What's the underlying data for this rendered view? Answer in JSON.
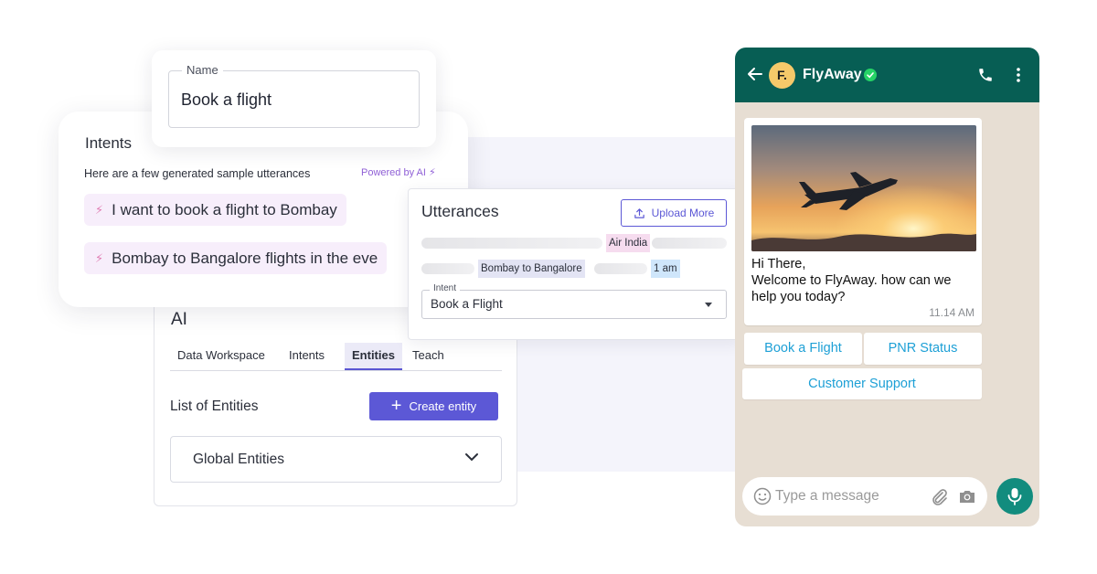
{
  "name_card": {
    "legend": "Name",
    "value": "Book a flight"
  },
  "intents_card": {
    "title": "Intents",
    "subtitle": "Here are a few generated sample utterances",
    "powered_by": "Powered by AI",
    "utterances": [
      "I want to book a flight to Bombay",
      "Bombay to Bangalore flights in the eve"
    ]
  },
  "ai_card": {
    "title": "AI",
    "tabs": [
      "Data Workspace",
      "Intents",
      "Entities",
      "Teach"
    ],
    "active_tab": "Entities",
    "list_label": "List of Entities",
    "create_button": "Create entity",
    "global_entities": "Global Entities"
  },
  "utterances_card": {
    "title": "Utterances",
    "upload_button": "Upload More",
    "tags": [
      "Air India",
      "Bombay to Bangalore",
      "1 am"
    ],
    "intent_legend": "Intent",
    "intent_value": "Book a Flight"
  },
  "whatsapp": {
    "avatar_initial": "F.",
    "contact_name": "FlyAway",
    "message_lines": [
      "Hi There,",
      "Welcome to FlyAway. how can we",
      "help you today?"
    ],
    "message_time": "11.14 AM",
    "quick_replies": [
      "Book a Flight",
      "PNR Status",
      "Customer Support"
    ],
    "input_placeholder": "Type a message",
    "colors": {
      "header": "#075e54",
      "chat_bg": "#e7ded3",
      "link": "#1ea0d6",
      "mic": "#128c7e",
      "verified": "#25d366"
    }
  },
  "colors": {
    "accent": "#5c58d6",
    "chip_bg": "#f7eefb",
    "powered": "#8f5fd6"
  }
}
